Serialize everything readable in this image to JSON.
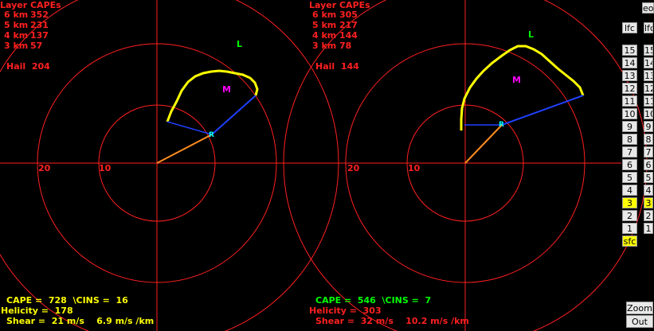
{
  "colors": {
    "bg": "#000000",
    "red": "#ff2020",
    "yellow": "#ffff00",
    "green": "#00ff00",
    "magenta": "#ff00ff",
    "blue": "#0000ff",
    "orange": "#ff8c20",
    "cyan": "#00ffff"
  },
  "left": {
    "layer_title": "Layer CAPEs",
    "layers": [
      {
        "label": "6 km",
        "value": "352"
      },
      {
        "label": "5 km",
        "value": "231"
      },
      {
        "label": "4 km",
        "value": "137"
      },
      {
        "label": "3 km",
        "value": "57"
      }
    ],
    "hail": "Hail  204",
    "ring_labels": [
      "20",
      "10"
    ],
    "L": "L",
    "M": "M",
    "R": "R",
    "cape_line": "CAPE =  728  \\CINS =  16",
    "helicity_line": "Helicity =  178",
    "shear_line": "Shear =  21 m/s    6.9 m/s /km"
  },
  "right": {
    "layer_title": "Layer CAPEs",
    "layers": [
      {
        "label": "6 km",
        "value": "305"
      },
      {
        "label": "5 km",
        "value": "217"
      },
      {
        "label": "4 km",
        "value": "144"
      },
      {
        "label": "3 km",
        "value": "78"
      }
    ],
    "hail": "Hail  144",
    "ring_labels": [
      "20",
      "10"
    ],
    "L": "L",
    "M": "M",
    "R": "R",
    "cape_line": "CAPE =  546  \\CINS =  7",
    "helicity_line": "Helicity =  303",
    "shear_line": "Shear =  32 m/s    10.2 m/s /km"
  },
  "buttons": {
    "top_partial": "eo",
    "lfc": "lfc",
    "levels": [
      "15",
      "14",
      "13",
      "12",
      "11",
      "10",
      "9",
      "8",
      "7",
      "6",
      "5",
      "4",
      "3",
      "2",
      "1"
    ],
    "sfc": "sfc",
    "zoom": "Zoom",
    "out": "Out"
  }
}
